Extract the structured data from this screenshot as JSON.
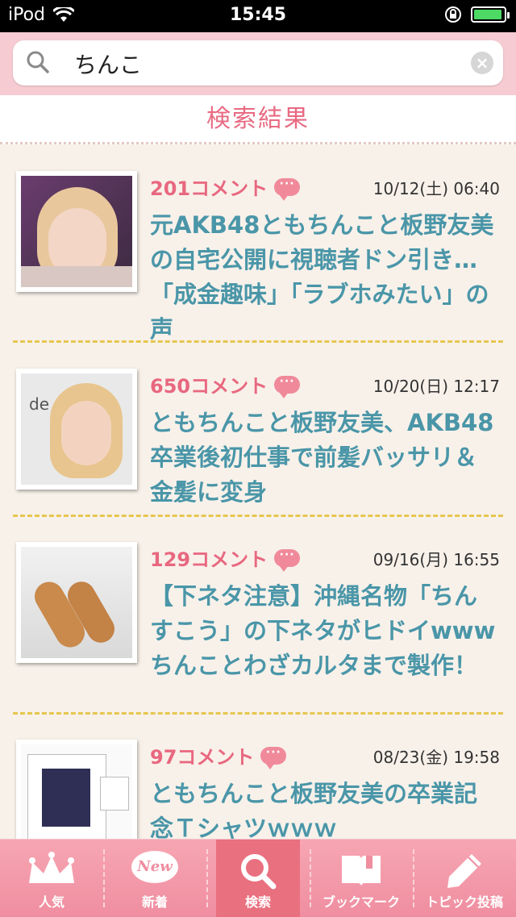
{
  "status_bar": {
    "carrier": "iPod",
    "time": "15:45"
  },
  "search": {
    "query": "ちんこ",
    "placeholder": ""
  },
  "results_heading": "検索結果",
  "results": [
    {
      "comments": "201コメント",
      "date": "10/12(土) 06:40",
      "title": "元AKB48ともちんこと板野友美の自宅公開に視聴者ドン引き…「成金趣味」「ラブホみたい」の声"
    },
    {
      "comments": "650コメント",
      "date": "10/20(日) 12:17",
      "title": "ともちんこと板野友美、AKB48卒業後初仕事で前髪バッサリ＆金髪に変身"
    },
    {
      "comments": "129コメント",
      "date": "09/16(月) 16:55",
      "title": "【下ネタ注意】沖縄名物「ちんすこう」の下ネタがヒドイwwwちんことわざカルタまで製作！"
    },
    {
      "comments": "97コメント",
      "date": "08/23(金) 19:58",
      "title": "ともちんこと板野友美の卒業記念Ｔシャツｗｗｗ"
    }
  ],
  "tabs": [
    {
      "label": "人気"
    },
    {
      "label": "新着",
      "badge": "New"
    },
    {
      "label": "検索"
    },
    {
      "label": "ブックマーク"
    },
    {
      "label": "トピック投稿"
    }
  ],
  "active_tab": "検索",
  "colors": {
    "accent_pink": "#e8687f",
    "title_teal": "#4a96a8",
    "tabbar_pink": "#ef8ea0",
    "separator_gold": "#e6c64e"
  }
}
